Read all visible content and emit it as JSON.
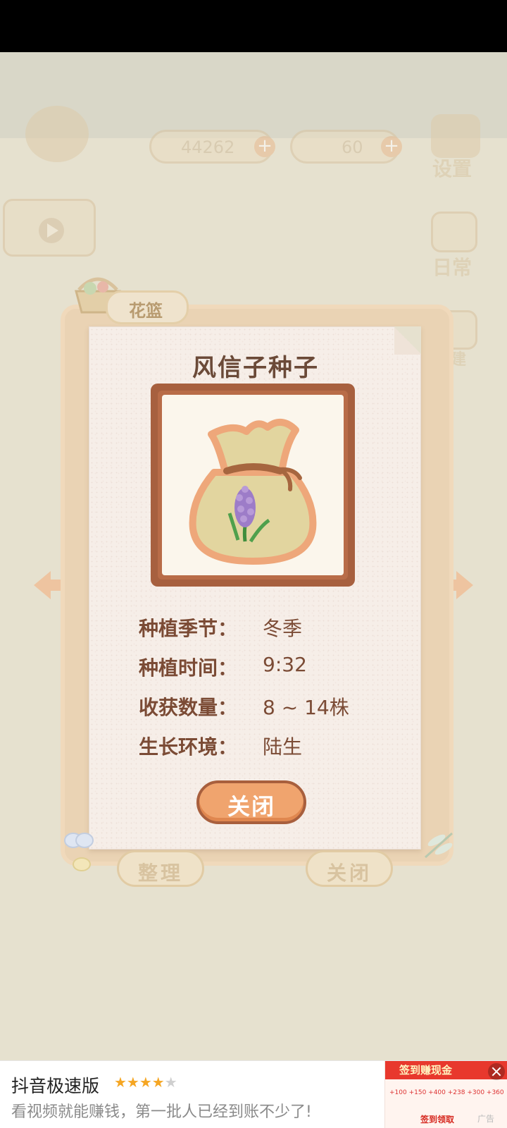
{
  "hud": {
    "coins": "44262",
    "gems": "60",
    "settings_label": "设置",
    "daily_label": "日常",
    "extra_label": "建"
  },
  "basket": {
    "tab_label": "花篮"
  },
  "item_card": {
    "title": "风信子种子",
    "rows": [
      {
        "label": "种植季节：",
        "value": "冬季"
      },
      {
        "label": "种植时间：",
        "value": "9:32"
      },
      {
        "label": "收获数量：",
        "value": "8 ~ 14株"
      },
      {
        "label": "生长环境：",
        "value": "陆生"
      }
    ],
    "close_label": "关闭"
  },
  "basket_buttons": {
    "sort_label": "整理",
    "close_label": "关闭"
  },
  "ad": {
    "app_name": "抖音极速版",
    "rating": 4,
    "description": "看视频就能赚钱，第一批人已经到账不少了!",
    "thumb_title": "签到赚现金",
    "thumb_row": "+100  +150  +400  +238  +300  +360",
    "thumb_button": "签到领取",
    "tag": "广告"
  },
  "colors": {
    "accent": "#f0a46e",
    "frame": "#a7603f",
    "text_brown": "#7b4b35"
  }
}
